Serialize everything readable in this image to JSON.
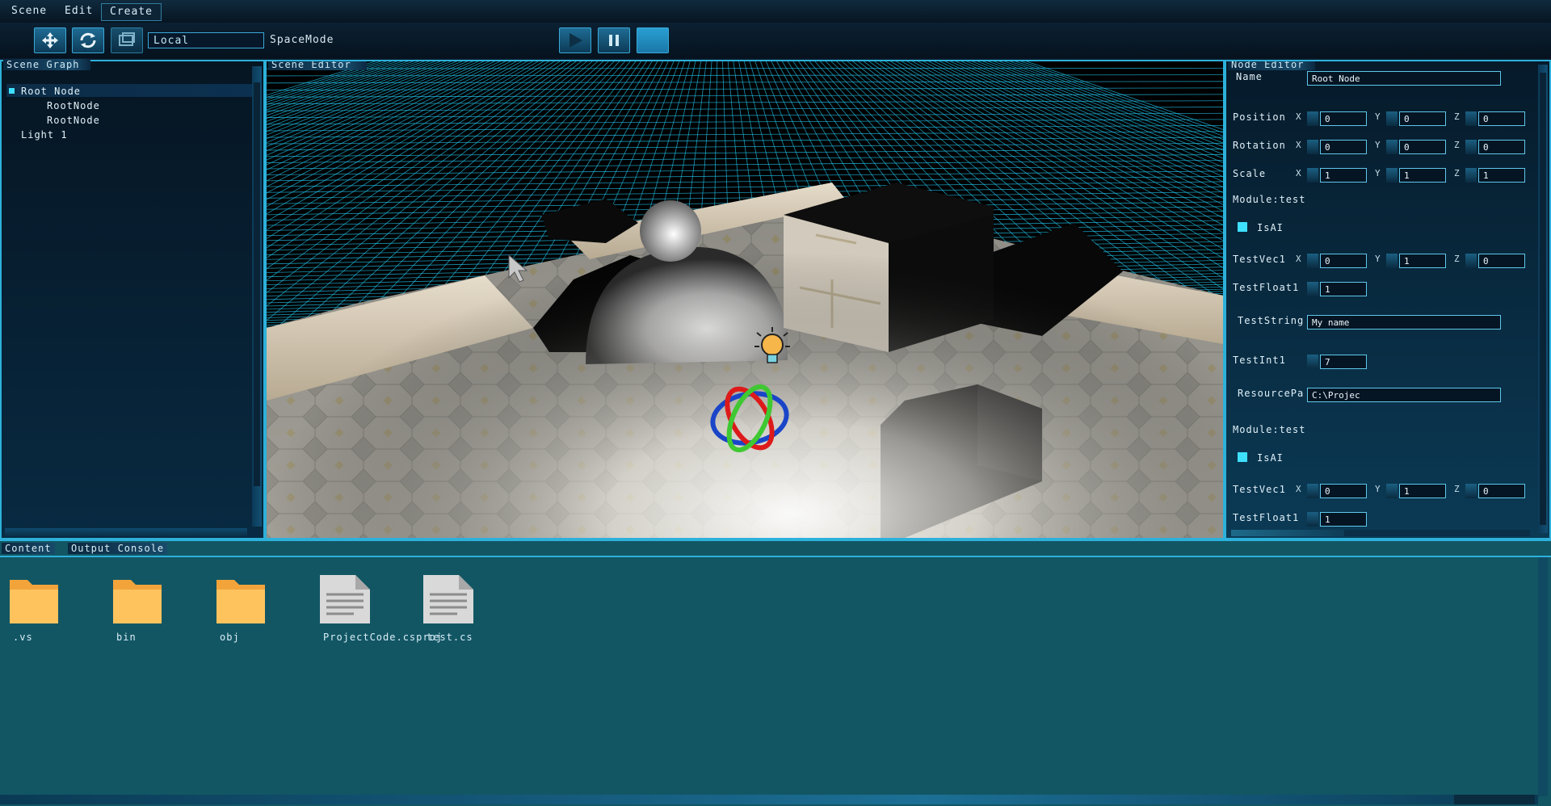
{
  "menu": {
    "items": [
      "Scene",
      "Edit",
      "Create"
    ]
  },
  "toolbar": {
    "space_value": "Local",
    "space_label": "SpaceMode"
  },
  "scene_graph": {
    "title": "Scene Graph",
    "items": [
      {
        "label": "Root Node",
        "level": 0
      },
      {
        "label": "RootNode",
        "level": 2
      },
      {
        "label": "RootNode",
        "level": 2
      },
      {
        "label": "Light 1",
        "level": 1
      }
    ]
  },
  "scene_editor": {
    "title": "Scene Editor"
  },
  "node_editor": {
    "title": "Node Editor",
    "name_label": "Name",
    "name_value": "Root Node",
    "position": {
      "label": "Position",
      "x": "0",
      "y": "0",
      "z": "0"
    },
    "rotation": {
      "label": "Rotation",
      "x": "0",
      "y": "0",
      "z": "0"
    },
    "scale": {
      "label": "Scale",
      "x": "1",
      "y": "1",
      "z": "1"
    },
    "axis": {
      "x": "X",
      "y": "Y",
      "z": "Z"
    },
    "module1": {
      "title": "Module:test",
      "isai": "IsAI",
      "testvec_label": "TestVec1",
      "testvec": {
        "x": "0",
        "y": "1",
        "z": "0"
      },
      "testfloat_label": "TestFloat1",
      "testfloat": "1",
      "teststring_label": "TestString",
      "teststring": "My name",
      "testint_label": "TestInt1",
      "testint": "7",
      "resource_label": "ResourcePа",
      "resource": "C:\\Projec"
    },
    "module2": {
      "title": "Module:test",
      "isai": "IsAI",
      "testvec_label": "TestVec1",
      "testvec": {
        "x": "0",
        "y": "1",
        "z": "0"
      },
      "testfloat_label": "TestFloat1",
      "testfloat": "1"
    }
  },
  "content": {
    "tabs": [
      "Content",
      "Output Console"
    ],
    "files": [
      {
        "name": ".vs",
        "icon": "folder-icon"
      },
      {
        "name": "bin",
        "icon": "folder-icon"
      },
      {
        "name": "obj",
        "icon": "folder-icon"
      },
      {
        "name": "ProjectCode.csproj",
        "icon": "file-icon"
      },
      {
        "name": "test.cs",
        "icon": "file-icon"
      }
    ]
  },
  "colors": {
    "accent": "#2db1da",
    "content_bg": "#125664",
    "grid": "#22c7f0"
  }
}
